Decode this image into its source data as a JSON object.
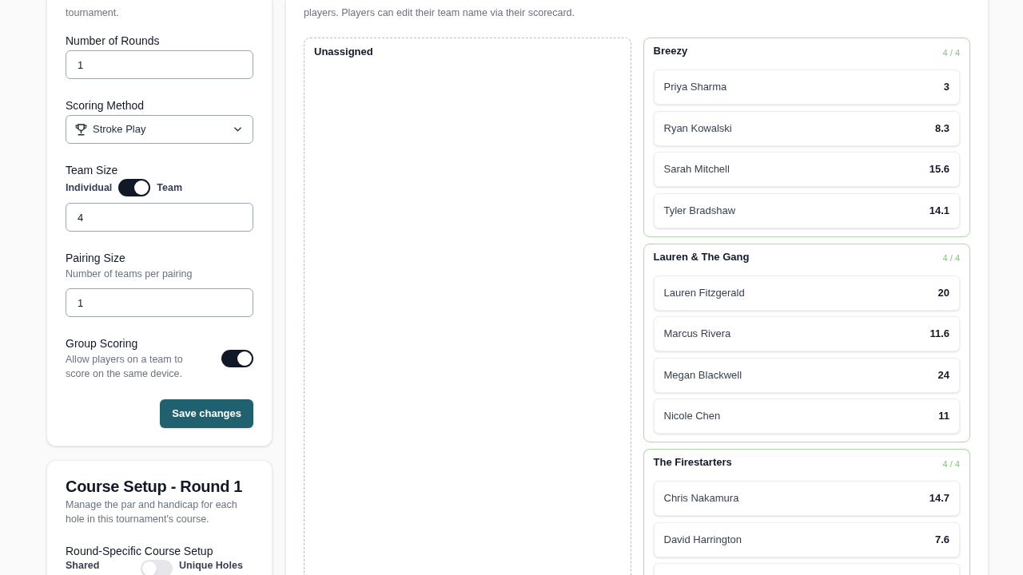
{
  "settings_card": {
    "description": "tournament.",
    "fields": [
      {
        "kind": "number",
        "label": "Number of Rounds",
        "value": "1"
      },
      {
        "kind": "select",
        "label": "Scoring Method",
        "value": "Stroke Play"
      },
      {
        "kind": "team_size",
        "label": "Team Size",
        "off_label": "Individual",
        "on_label": "Team",
        "on": true,
        "value": "4"
      },
      {
        "kind": "number",
        "label": "Pairing Size",
        "hint": "Number of teams per pairing",
        "value": "1"
      },
      {
        "kind": "switch",
        "label": "Group Scoring",
        "hint": "Allow players on a team to score on the same device.",
        "on": true
      }
    ],
    "save_button": "Save changes"
  },
  "course_card": {
    "title": "Course Setup - Round 1",
    "description": "Manage the par and handicap for each hole in this tournament's course.",
    "setting": {
      "label": "Round-Specific Course Setup",
      "off_label": "Shared",
      "on_label": "Unique Holes",
      "on": false
    }
  },
  "teams_panel": {
    "description": "players. Players can edit their team name via their scorecard.",
    "unassigned": {
      "title": "Unassigned"
    },
    "teams": [
      {
        "name": "Breezy",
        "count": "4 / 4",
        "full": true,
        "continues": false,
        "players": [
          {
            "name": "Priya Sharma",
            "value": "3"
          },
          {
            "name": "Ryan Kowalski",
            "value": "8.3"
          },
          {
            "name": "Sarah Mitchell",
            "value": "15.6"
          },
          {
            "name": "Tyler Bradshaw",
            "value": "14.1"
          }
        ]
      },
      {
        "name": "Lauren & The Gang",
        "count": "4 / 4",
        "full": true,
        "continues": false,
        "players": [
          {
            "name": "Lauren Fitzgerald",
            "value": "20"
          },
          {
            "name": "Marcus Rivera",
            "value": "11.6"
          },
          {
            "name": "Megan Blackwell",
            "value": "24"
          },
          {
            "name": "Nicole Chen",
            "value": "11"
          }
        ]
      },
      {
        "name": "The Firestarters",
        "count": "4 / 4",
        "full": true,
        "continues": true,
        "players": [
          {
            "name": "Chris Nakamura",
            "value": "14.7"
          },
          {
            "name": "David Harrington",
            "value": "7.6"
          }
        ]
      }
    ]
  }
}
